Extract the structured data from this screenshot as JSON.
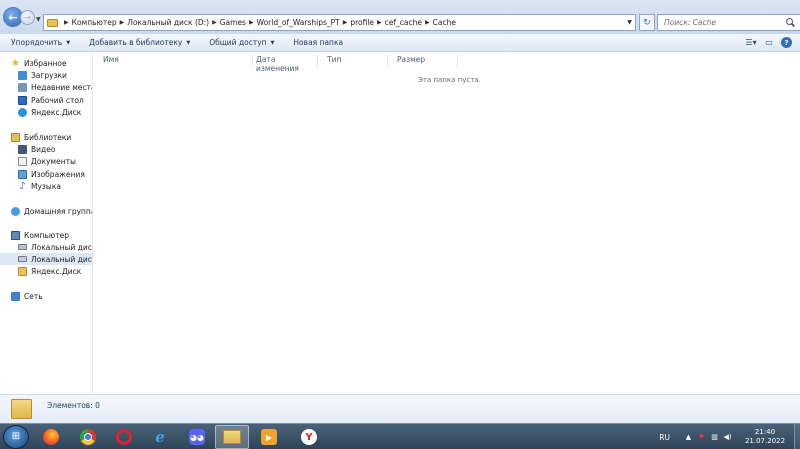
{
  "address": {
    "breadcrumbs": [
      "Компьютер",
      "Локальный диск (D:)",
      "Games",
      "World_of_Warships_PT",
      "profile",
      "cef_cache",
      "Cache"
    ],
    "search_placeholder": "Поиск: Cache"
  },
  "toolbar": {
    "organize": "Упорядочить",
    "add_to_library": "Добавить в библиотеку",
    "share": "Общий доступ",
    "new_folder": "Новая папка"
  },
  "nav": {
    "favorites": "Избранное",
    "downloads": "Загрузки",
    "recent": "Недавние места",
    "desktop": "Рабочий стол",
    "yadisk": "Яндекс.Диск",
    "libraries": "Библиотеки",
    "video": "Видео",
    "documents": "Документы",
    "images": "Изображения",
    "music": "Музыка",
    "homegroup": "Домашняя группа",
    "computer": "Компьютер",
    "disk_c": "Локальный диск (C",
    "disk_d": "Локальный диск (D",
    "yadisk_folder": "Яндекс.Диск",
    "network": "Сеть"
  },
  "columns": {
    "name": "Имя",
    "date": "Дата изменения",
    "type": "Тип",
    "size": "Размер"
  },
  "empty_message": "Эта папка пуста.",
  "status": {
    "items": "Элементов: 0"
  },
  "taskbar": {
    "language": "RU",
    "time": "21:40",
    "date": "21.07.2022"
  },
  "colors": {
    "toolbar_text": "#1e395b",
    "selected_row": "#dce8f6",
    "taskbar": "#2e4458"
  }
}
